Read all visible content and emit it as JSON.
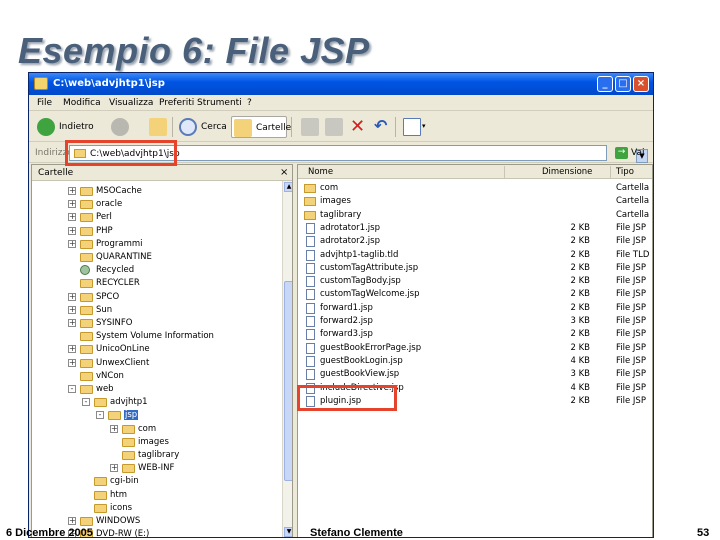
{
  "slide": {
    "title": "Esempio 6: File JSP",
    "footer_date": "6 Dicembre 2005",
    "footer_author": "Stefano Clemente",
    "page_number": "53"
  },
  "window": {
    "title": "C:\\web\\advjhtp1\\jsp",
    "buttons": [
      "_",
      "□",
      "×"
    ]
  },
  "menu": [
    "File",
    "Modifica",
    "Visualizza",
    "Preferiti",
    "Strumenti",
    "?"
  ],
  "toolbar": {
    "back_label": "Indietro",
    "search_label": "Cerca",
    "folders_label": "Cartelle"
  },
  "address": {
    "label": "Indirizzo",
    "value": "C:\\web\\advjhtp1\\jsp",
    "go_label": "Vai"
  },
  "tree": {
    "header": "Cartelle",
    "close_glyph": "×",
    "items": [
      {
        "label": "MSOCache",
        "exp": "+"
      },
      {
        "label": "oracle",
        "exp": "+"
      },
      {
        "label": "Perl",
        "exp": "+"
      },
      {
        "label": "PHP",
        "exp": "+"
      },
      {
        "label": "Programmi",
        "exp": "+"
      },
      {
        "label": "QUARANTINE",
        "exp": ""
      },
      {
        "label": "Recycled",
        "exp": ""
      },
      {
        "label": "RECYCLER",
        "exp": ""
      },
      {
        "label": "SPCO",
        "exp": "+"
      },
      {
        "label": "Sun",
        "exp": "+"
      },
      {
        "label": "SYSINFO",
        "exp": "+"
      },
      {
        "label": "System Volume Information",
        "exp": ""
      },
      {
        "label": "UnicoOnLine",
        "exp": "+"
      },
      {
        "label": "UnwexClient",
        "exp": "+"
      },
      {
        "label": "vNCon",
        "exp": ""
      },
      {
        "label": "web",
        "exp": "-"
      },
      {
        "label": "advjhtp1",
        "exp": "-"
      },
      {
        "label": "jsp",
        "exp": "-"
      },
      {
        "label": "com",
        "exp": "+"
      },
      {
        "label": "images",
        "exp": ""
      },
      {
        "label": "taglibrary",
        "exp": ""
      },
      {
        "label": "WEB-INF",
        "exp": "+"
      },
      {
        "label": "cgi-bin",
        "exp": ""
      },
      {
        "label": "htm",
        "exp": ""
      },
      {
        "label": "icons",
        "exp": ""
      },
      {
        "label": "WINDOWS",
        "exp": "+"
      },
      {
        "label": "DVD-RW (E:)",
        "exp": "+"
      }
    ]
  },
  "list": {
    "columns": {
      "name": "Nome",
      "size": "Dimensione",
      "type": "Tipo"
    },
    "rows": [
      {
        "name": "com",
        "size": "",
        "type": "Cartella",
        "kind": "folder"
      },
      {
        "name": "images",
        "size": "",
        "type": "Cartella",
        "kind": "folder"
      },
      {
        "name": "taglibrary",
        "size": "",
        "type": "Cartella",
        "kind": "folder"
      },
      {
        "name": "adrotator1.jsp",
        "size": "2 KB",
        "type": "File JSP",
        "kind": "file"
      },
      {
        "name": "adrotator2.jsp",
        "size": "2 KB",
        "type": "File JSP",
        "kind": "file"
      },
      {
        "name": "advjhtp1-taglib.tld",
        "size": "2 KB",
        "type": "File TLD",
        "kind": "file"
      },
      {
        "name": "customTagAttribute.jsp",
        "size": "2 KB",
        "type": "File JSP",
        "kind": "file"
      },
      {
        "name": "customTagBody.jsp",
        "size": "2 KB",
        "type": "File JSP",
        "kind": "file"
      },
      {
        "name": "customTagWelcome.jsp",
        "size": "2 KB",
        "type": "File JSP",
        "kind": "file"
      },
      {
        "name": "forward1.jsp",
        "size": "2 KB",
        "type": "File JSP",
        "kind": "file"
      },
      {
        "name": "forward2.jsp",
        "size": "3 KB",
        "type": "File JSP",
        "kind": "file"
      },
      {
        "name": "forward3.jsp",
        "size": "2 KB",
        "type": "File JSP",
        "kind": "file"
      },
      {
        "name": "guestBookErrorPage.jsp",
        "size": "2 KB",
        "type": "File JSP",
        "kind": "file"
      },
      {
        "name": "guestBookLogin.jsp",
        "size": "4 KB",
        "type": "File JSP",
        "kind": "file"
      },
      {
        "name": "guestBookView.jsp",
        "size": "3 KB",
        "type": "File JSP",
        "kind": "file"
      },
      {
        "name": "includeDirective.jsp",
        "size": "4 KB",
        "type": "File JSP",
        "kind": "file"
      },
      {
        "name": "plugin.jsp",
        "size": "2 KB",
        "type": "File JSP",
        "kind": "file"
      }
    ]
  },
  "colors": {
    "titlebar": "#0055e5",
    "highlight": "#e5432b",
    "selection": "#316ac5",
    "slide_title": "#4a5f7a"
  }
}
